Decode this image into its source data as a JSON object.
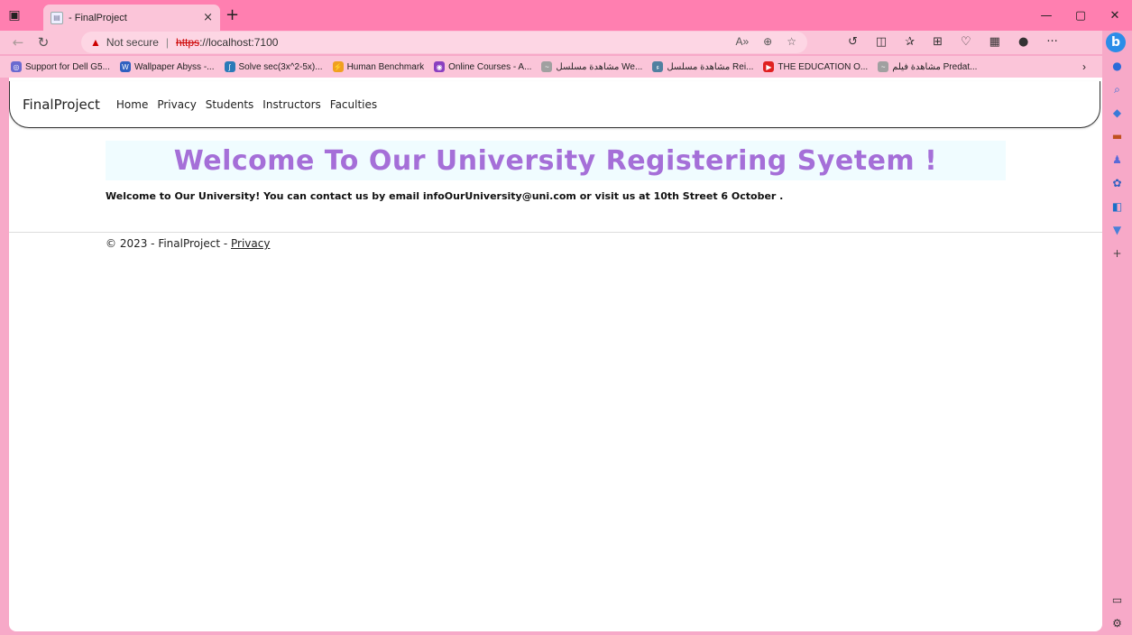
{
  "browser": {
    "tab_title": "- FinalProject",
    "tab_close": "×",
    "new_tab": "+",
    "not_secure": "Not secure",
    "url_scheme": "https",
    "url_rest": "://localhost:7100",
    "minimize": "—",
    "restore": "▢",
    "close": "✕"
  },
  "bookmarks": [
    {
      "label": "Support for Dell G5...",
      "color": "#6a6ad0",
      "glyph": "◎"
    },
    {
      "label": "Wallpaper Abyss -...",
      "color": "#3060c0",
      "glyph": "W"
    },
    {
      "label": "Solve sec(3x^2-5x)...",
      "color": "#2a7ab8",
      "glyph": "∫"
    },
    {
      "label": "Human Benchmark",
      "color": "#f0a020",
      "glyph": "⚡"
    },
    {
      "label": "Online Courses - A...",
      "color": "#8a40c0",
      "glyph": "◉"
    },
    {
      "label": "مشاهدة مسلسل We...",
      "color": "#a0a0a0",
      "glyph": "~"
    },
    {
      "label": "مشاهدة مسلسل Rei...",
      "color": "#5080a0",
      "glyph": "ء"
    },
    {
      "label": "THE EDUCATION O...",
      "color": "#e02020",
      "glyph": "▶"
    },
    {
      "label": "مشاهدة فيلم Predat...",
      "color": "#a0a0a0",
      "glyph": "~"
    }
  ],
  "site": {
    "brand": "FinalProject",
    "nav": [
      "Home",
      "Privacy",
      "Students",
      "Instructors",
      "Faculties"
    ],
    "welcome_title": "Welcome To Our University Registering Syetem !",
    "welcome_text": "Welcome to Our University! You can contact us by email infoOurUniversity@uni.com or visit us at 10th Street 6 October .",
    "footer_prefix": "© 2023 - FinalProject - ",
    "footer_link": "Privacy"
  }
}
